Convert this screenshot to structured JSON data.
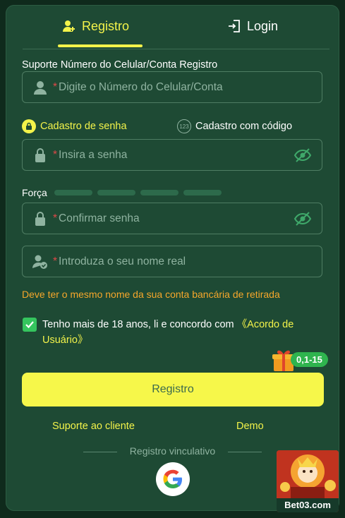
{
  "tabs": {
    "register": "Registro",
    "login": "Login"
  },
  "phone_section": {
    "label": "Suporte Número do Celular/Conta Registro",
    "placeholder": "Digite o Número do Celular/Conta"
  },
  "methods": {
    "password": "Cadastro de senha",
    "code": "Cadastro com código",
    "code_icon_text": "123"
  },
  "password_field": {
    "placeholder": "Insira a senha"
  },
  "strength": {
    "label": "Força",
    "level": 0
  },
  "confirm_field": {
    "placeholder": "Confirmar senha"
  },
  "name_field": {
    "placeholder": "Introduza o seu nome real"
  },
  "name_warning": "Deve ter o mesmo nome da sua conta bancária de retirada",
  "agreement": {
    "checked": true,
    "text": "Tenho mais de 18 anos, li e concordo com ",
    "link": "《Acordo de Usuário》"
  },
  "bonus_badge": "0,1-15",
  "submit_label": "Registro",
  "footer_links": {
    "support": "Suporte ao cliente",
    "demo": "Demo"
  },
  "linked_register": "Registro vinculativo",
  "promo": {
    "brand": "Bet03.com"
  },
  "required_mark": "*",
  "colors": {
    "accent": "#f3f34a",
    "panel": "#1e4a34",
    "warning": "#f6a72b",
    "check": "#35c55e"
  },
  "icons": [
    "user-plus-icon",
    "login-icon",
    "user-icon",
    "lock-icon",
    "eye-off-icon",
    "user-check-icon",
    "check-icon",
    "gift-icon",
    "google-icon"
  ]
}
